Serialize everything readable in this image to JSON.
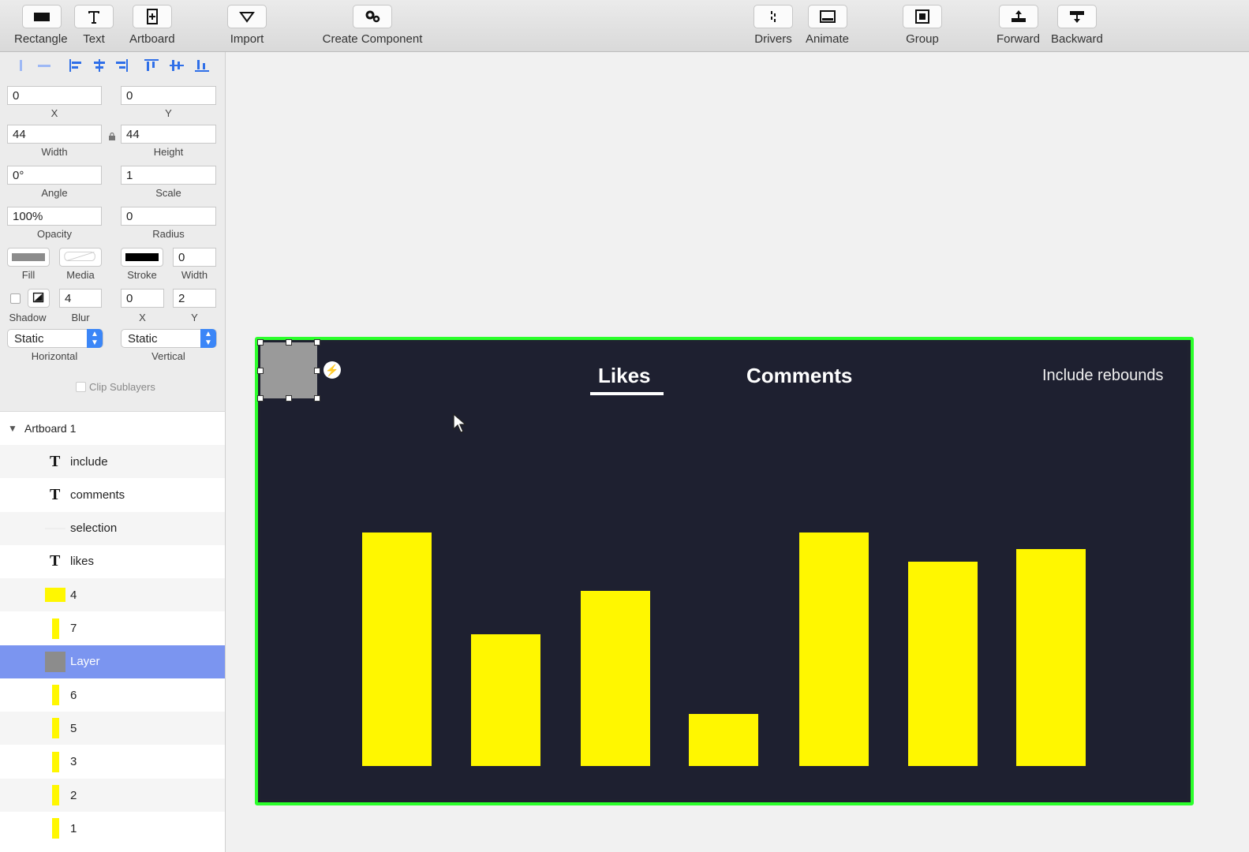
{
  "toolbar": {
    "rectangle": "Rectangle",
    "text": "Text",
    "artboard": "Artboard",
    "import": "Import",
    "create_component": "Create Component",
    "drivers": "Drivers",
    "animate": "Animate",
    "group": "Group",
    "forward": "Forward",
    "backward": "Backward"
  },
  "inspector": {
    "x": {
      "value": "0",
      "label": "X"
    },
    "y": {
      "value": "0",
      "label": "Y"
    },
    "width": {
      "value": "44",
      "label": "Width"
    },
    "height": {
      "value": "44",
      "label": "Height"
    },
    "angle": {
      "value": "0°",
      "label": "Angle"
    },
    "scale": {
      "value": "1",
      "label": "Scale"
    },
    "opacity": {
      "value": "100%",
      "label": "Opacity"
    },
    "radius": {
      "value": "0",
      "label": "Radius"
    },
    "fill_label": "Fill",
    "media_label": "Media",
    "stroke_label": "Stroke",
    "stroke_width": {
      "value": "0",
      "label": "Width"
    },
    "shadow_label": "Shadow",
    "blur": {
      "value": "4",
      "label": "Blur"
    },
    "shadow_x": {
      "value": "0",
      "label": "X"
    },
    "shadow_y": {
      "value": "2",
      "label": "Y"
    },
    "horizontal": {
      "value": "Static",
      "label": "Horizontal"
    },
    "vertical": {
      "value": "Static",
      "label": "Vertical"
    },
    "clip_sublayers": "Clip Sublayers",
    "fill_color": "#8c8c8c",
    "stroke_color": "#000000"
  },
  "layers": {
    "root": "Artboard 1",
    "items": [
      {
        "name": "include",
        "kind": "text"
      },
      {
        "name": "comments",
        "kind": "text"
      },
      {
        "name": "selection",
        "kind": "shape"
      },
      {
        "name": "likes",
        "kind": "text"
      },
      {
        "name": "4",
        "kind": "bar"
      },
      {
        "name": "7",
        "kind": "bar"
      },
      {
        "name": "Layer",
        "kind": "selected"
      },
      {
        "name": "6",
        "kind": "bar"
      },
      {
        "name": "5",
        "kind": "bar"
      },
      {
        "name": "3",
        "kind": "bar"
      },
      {
        "name": "2",
        "kind": "bar"
      },
      {
        "name": "1",
        "kind": "bar"
      }
    ]
  },
  "artboard": {
    "tab_likes": "Likes",
    "tab_comments": "Comments",
    "include_rebounds": "Include rebounds",
    "bar_color": "#fff700",
    "background": "#1e2030",
    "selection_outline": "#2bff2b"
  }
}
